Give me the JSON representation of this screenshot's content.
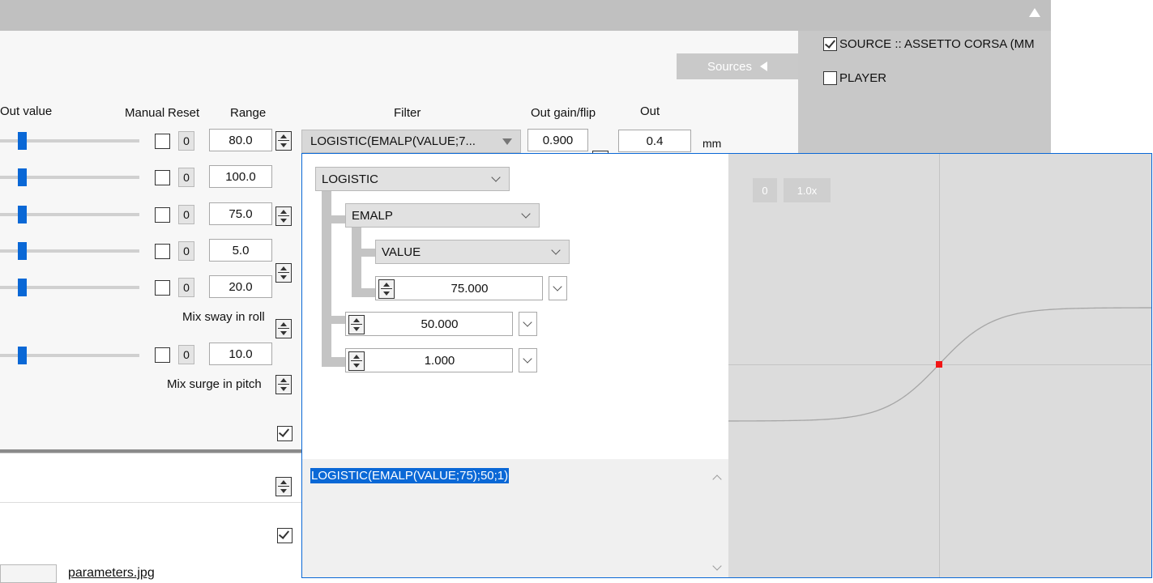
{
  "sources": {
    "tab_label": "Sources",
    "items": [
      {
        "label": "SOURCE :: ASSETTO CORSA (MM",
        "checked": true
      },
      {
        "label": "PLAYER",
        "checked": false
      }
    ]
  },
  "table": {
    "headers": {
      "out_value": "Out value",
      "manual": "Manual",
      "reset": "Reset",
      "range": "Range",
      "filter": "Filter",
      "out_gain": "Out gain/flip",
      "out": "Out"
    },
    "rows": [
      {
        "slider_pct": 0.16,
        "manual": false,
        "reset": "0",
        "range": "80.0"
      },
      {
        "slider_pct": 0.16,
        "manual": false,
        "reset": "0",
        "range": "100.0"
      },
      {
        "slider_pct": 0.16,
        "manual": false,
        "reset": "0",
        "range": "75.0"
      },
      {
        "slider_pct": 0.16,
        "manual": false,
        "reset": "0",
        "range": "5.0"
      },
      {
        "slider_pct": 0.16,
        "manual": false,
        "reset": "0",
        "range": "20.0"
      },
      {
        "slider_pct": 0.16,
        "manual": false,
        "reset": "0",
        "range": "10.0"
      }
    ],
    "mix_sway_label": "Mix sway in roll",
    "mix_sway_checked": true,
    "mix_surge_label": "Mix surge in pitch",
    "mix_surge_checked": true,
    "filter_value": "LOGISTIC(EMALP(VALUE;7...",
    "gain_value": "0.900",
    "out_value": "0.4",
    "out_unit": "mm"
  },
  "file": {
    "link": "parameters.jpg"
  },
  "filter_editor": {
    "tree": {
      "fn_root": "LOGISTIC",
      "fn_child": "EMALP",
      "fn_leaf": "VALUE",
      "emalp_param": "75.000",
      "logistic_param1": "50.000",
      "logistic_param2": "1.000"
    },
    "expression": "LOGISTIC(EMALP(VALUE;75);50;1)",
    "graph": {
      "buttons": [
        "0",
        "1.0x"
      ],
      "colors": {
        "curve": "#a6a6a6",
        "marker": "#f21515",
        "axis": "#c4c4c4"
      }
    }
  },
  "chart_data": {
    "type": "line",
    "function": "logistic",
    "midpoint": 0,
    "current_point": {
      "x": 0,
      "y": 0.5
    },
    "grid": false
  }
}
